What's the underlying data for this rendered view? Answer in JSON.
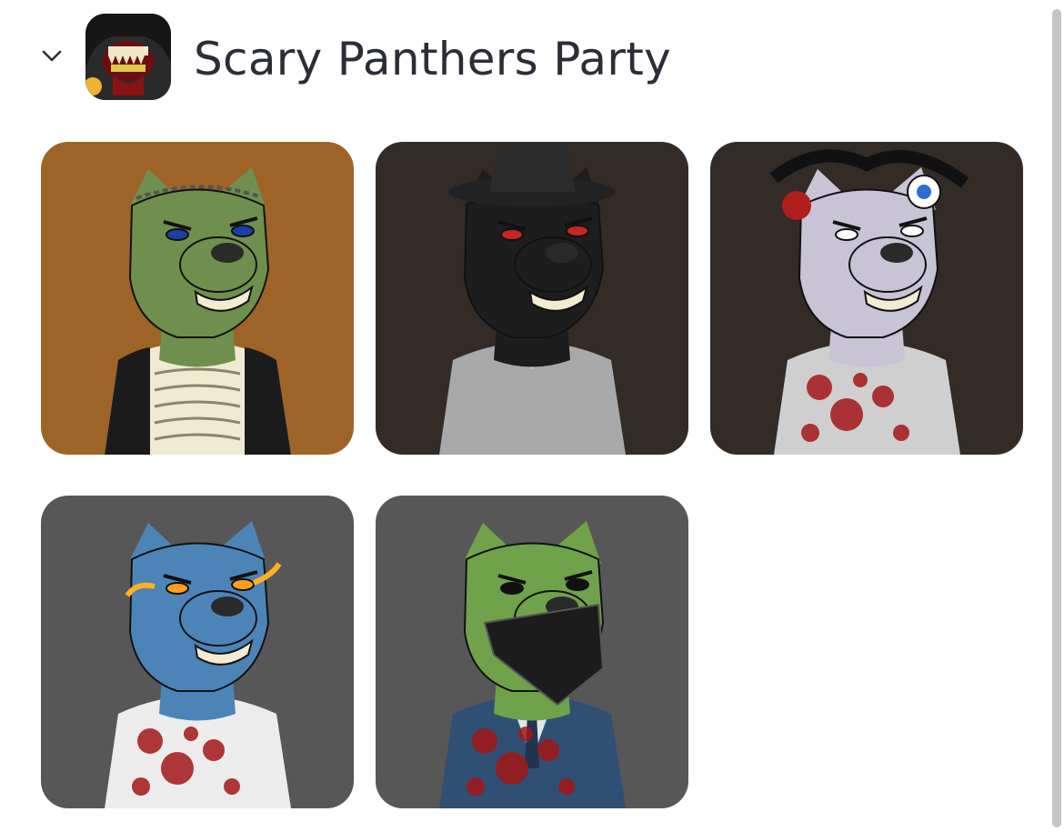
{
  "collection": {
    "title": "Scary Panthers Party",
    "avatar_icon": "scary-panther-avatar-icon",
    "expanded": true
  },
  "nfts": [
    {
      "bg": "#9e6427",
      "fur": "#6f8f4f",
      "outfit": "skeleton",
      "accent": "#f0ead2",
      "eyes": "#1a3fa8",
      "feature": "stitches"
    },
    {
      "bg": "#332b26",
      "fur": "#1d1d1d",
      "outfit": "grey-coat",
      "accent": "#a8a8a8",
      "eyes": "#c2281f",
      "feature": "cowboy-hat"
    },
    {
      "bg": "#332b26",
      "fur": "#c9c3d6",
      "outfit": "bloody-shirt",
      "accent": "#cfcfcf",
      "eyes": "#ffffff",
      "feature": "eyeball-hair"
    },
    {
      "bg": "#575757",
      "fur": "#4d84b8",
      "outfit": "bloody-shirt",
      "accent": "#ececec",
      "eyes": "#ff9f1c",
      "feature": "glowing-eyes"
    },
    {
      "bg": "#575757",
      "fur": "#6fa24a",
      "outfit": "blue-suit",
      "accent": "#2f4f73",
      "eyes": "#111111",
      "feature": "bandana"
    }
  ]
}
